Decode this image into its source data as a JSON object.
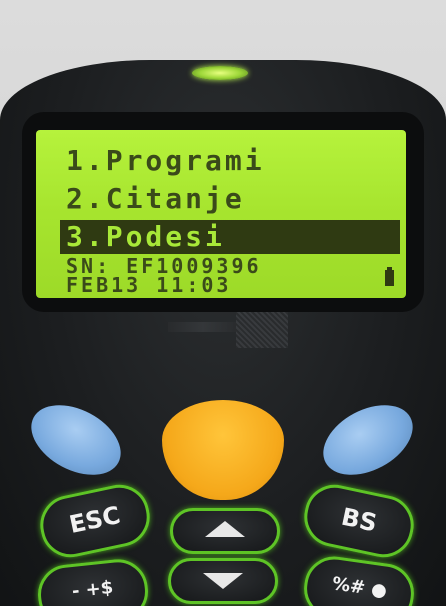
{
  "screen": {
    "menu": [
      "1.Programi",
      "2.Citanje",
      "3.Podesi"
    ],
    "selected_index": 2,
    "serial": "SN: EF1009396",
    "datetime": "FEB13 11:03"
  },
  "keys": {
    "esc": "ESC",
    "bs": "BS",
    "minus": "- +$",
    "percent": "%# ●"
  },
  "icons": {
    "battery": "battery-icon",
    "up": "arrow-up-icon",
    "down": "arrow-down-icon"
  },
  "colors": {
    "lcd": "#a6e42e",
    "lcd_text": "#3a4a1a",
    "side_key": "#78a9de",
    "scan_key": "#f5a81a",
    "key_glow": "#5ec426"
  }
}
